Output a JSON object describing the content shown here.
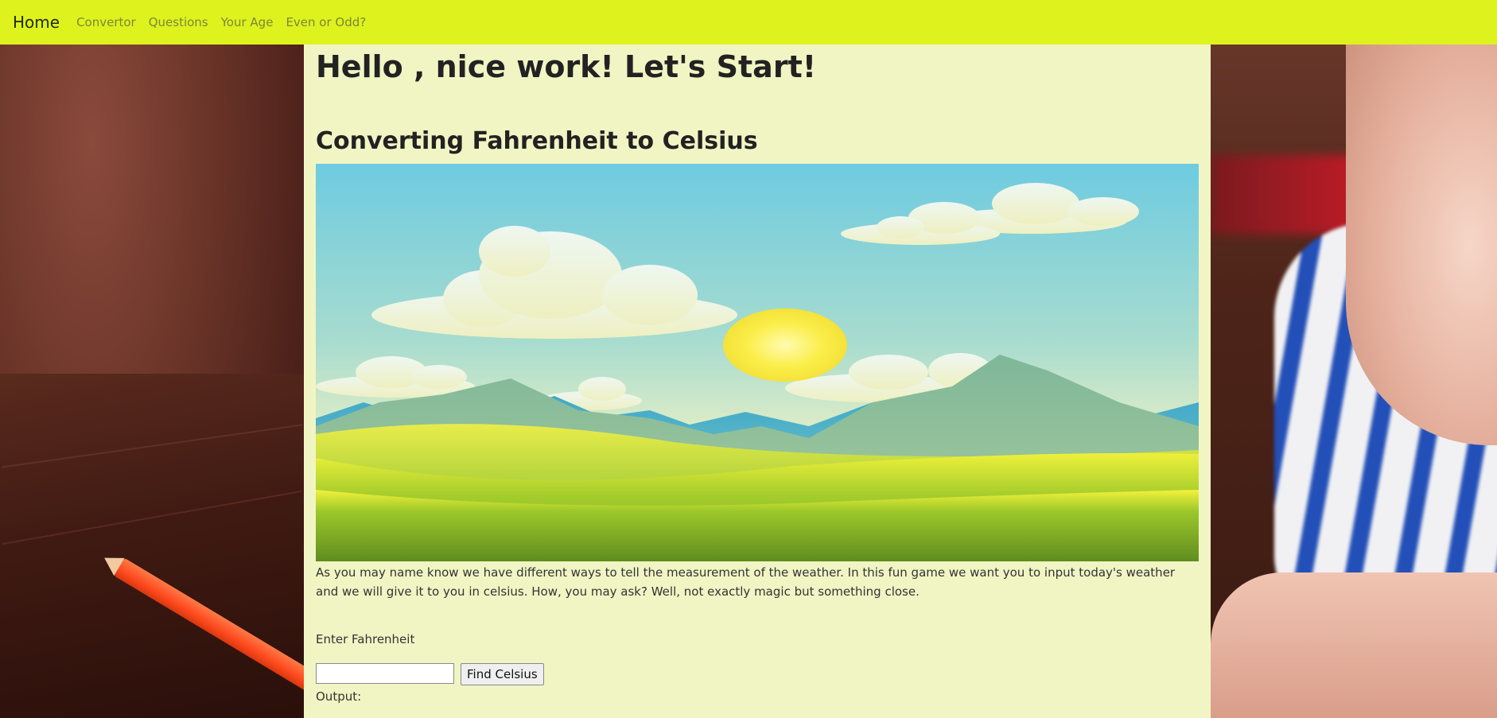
{
  "navbar": {
    "brand": "Home",
    "links": [
      "Convertor",
      "Questions",
      "Your Age",
      "Even or Odd?"
    ],
    "background": "#def21e"
  },
  "main": {
    "heading": "Hello , nice work! Let's Start!",
    "subheading": "Converting Fahrenheit to Celsius",
    "description": "As you may name know we have different ways to tell the measurement of the weather. In this fun game we want you to input today's weather and we will give it to you in celsius. How, you may ask? Well, not exactly magic but something close.",
    "input_label": "Enter Fahrenheit",
    "input_value": "",
    "button_label": "Find Celsius",
    "output_label": "Output:",
    "background": "#f1f5c4"
  }
}
